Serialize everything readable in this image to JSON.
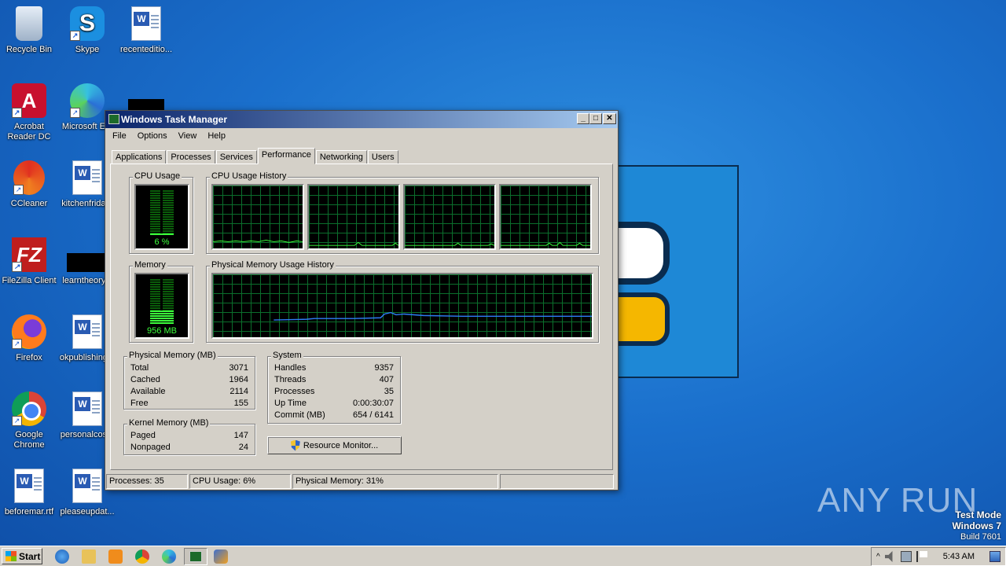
{
  "desktop": {
    "icons": [
      {
        "label": "Recycle Bin",
        "icon": "recycle-bin-icon"
      },
      {
        "label": "Skype",
        "icon": "skype-icon"
      },
      {
        "label": "recenteditio...",
        "icon": "word-document-icon"
      },
      {
        "label": "Acrobat Reader DC",
        "icon": "acrobat-icon"
      },
      {
        "label": "Microsoft E...",
        "icon": "edge-icon"
      },
      {
        "label": "CCleaner",
        "icon": "ccleaner-icon"
      },
      {
        "label": "kitchenfrida...",
        "icon": "word-document-icon"
      },
      {
        "label": "FileZilla Client",
        "icon": "filezilla-icon"
      },
      {
        "label": "learntheory...",
        "icon": "file-icon"
      },
      {
        "label": "Firefox",
        "icon": "firefox-icon"
      },
      {
        "label": "okpublishing...",
        "icon": "word-document-icon"
      },
      {
        "label": "Google Chrome",
        "icon": "chrome-icon"
      },
      {
        "label": "personalcos...",
        "icon": "word-document-icon"
      },
      {
        "label": "beforemar.rtf",
        "icon": "word-document-icon"
      },
      {
        "label": "pleaseupdat...",
        "icon": "word-document-icon"
      }
    ],
    "watermark": "ANY RUN",
    "test_mode": {
      "line1": "Test Mode",
      "line2": "Windows 7",
      "line3": "Build 7601"
    }
  },
  "task_manager": {
    "title": "Windows Task Manager",
    "menu": [
      "File",
      "Options",
      "View",
      "Help"
    ],
    "tabs": [
      "Applications",
      "Processes",
      "Services",
      "Performance",
      "Networking",
      "Users"
    ],
    "active_tab": "Performance",
    "cpu_usage": {
      "label": "CPU Usage",
      "value": "6 %",
      "percent": 6
    },
    "cpu_history": {
      "label": "CPU Usage History"
    },
    "memory": {
      "label": "Memory",
      "value": "956 MB",
      "percent": 31
    },
    "memory_history": {
      "label": "Physical Memory Usage History"
    },
    "physical_memory": {
      "label": "Physical Memory (MB)",
      "rows": [
        {
          "name": "Total",
          "value": "3071"
        },
        {
          "name": "Cached",
          "value": "1964"
        },
        {
          "name": "Available",
          "value": "2114"
        },
        {
          "name": "Free",
          "value": "155"
        }
      ]
    },
    "kernel_memory": {
      "label": "Kernel Memory (MB)",
      "rows": [
        {
          "name": "Paged",
          "value": "147"
        },
        {
          "name": "Nonpaged",
          "value": "24"
        }
      ]
    },
    "system": {
      "label": "System",
      "rows": [
        {
          "name": "Handles",
          "value": "9357"
        },
        {
          "name": "Threads",
          "value": "407"
        },
        {
          "name": "Processes",
          "value": "35"
        },
        {
          "name": "Up Time",
          "value": "0:00:30:07"
        },
        {
          "name": "Commit (MB)",
          "value": "654 / 6141"
        }
      ]
    },
    "resource_monitor_button": "Resource Monitor...",
    "status": {
      "processes": "Processes: 35",
      "cpu": "CPU Usage: 6%",
      "memory": "Physical Memory: 31%"
    }
  },
  "taskbar": {
    "start_label": "Start",
    "clock": "5:43 AM"
  }
}
